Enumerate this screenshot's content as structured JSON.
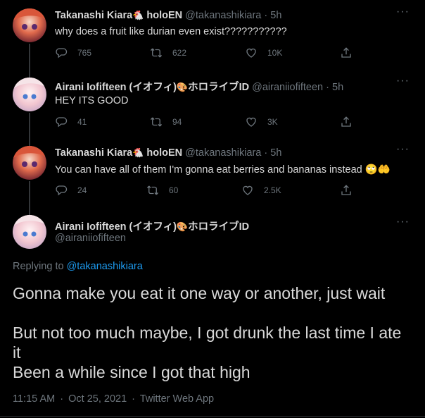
{
  "tweets": [
    {
      "name": "Takanashi Kiara",
      "badge_text": "holoEN",
      "handle": "@takanashikiara",
      "time": "5h",
      "text": "why does a fruit like durian even exist???????????",
      "replies": "765",
      "retweets": "622",
      "likes": "10K"
    },
    {
      "name": "Airani Iofifteen (イオフィ)",
      "badge_text": "ホロライブID",
      "handle": "@airaniiofifteen",
      "time": "5h",
      "text": "HEY ITS GOOD",
      "replies": "41",
      "retweets": "94",
      "likes": "3K"
    },
    {
      "name": "Takanashi Kiara",
      "badge_text": "holoEN",
      "handle": "@takanashikiara",
      "time": "5h",
      "text": "You can have all of them I'm gonna eat berries and bananas instead 🙄🤲",
      "replies": "24",
      "retweets": "60",
      "likes": "2.5K"
    }
  ],
  "main_tweet": {
    "name": "Airani Iofifteen (イオフィ)",
    "badge_text": "ホロライブID",
    "handle": "@airaniiofifteen",
    "replying_prefix": "Replying to",
    "replying_to": "@takanashikiara",
    "line1": "Gonna make you eat it one way or another, just wait",
    "line2": "But not too much maybe, I got drunk the last time I ate it",
    "line3": "Been a while since I got that high",
    "time": "11:15 AM",
    "date": "Oct 25, 2021",
    "source": "Twitter Web App"
  },
  "dot": "·",
  "more_glyph": "···",
  "icons": {
    "reply": "reply-icon",
    "retweet": "retweet-icon",
    "like": "heart-icon",
    "share": "share-icon",
    "kiara_badge": "chicken-emoji",
    "iofi_badge": "palette-emoji"
  },
  "colors": {
    "background": "#000000",
    "text": "#d9d9d9",
    "secondary": "#6e767d",
    "link": "#1d9bf0"
  }
}
